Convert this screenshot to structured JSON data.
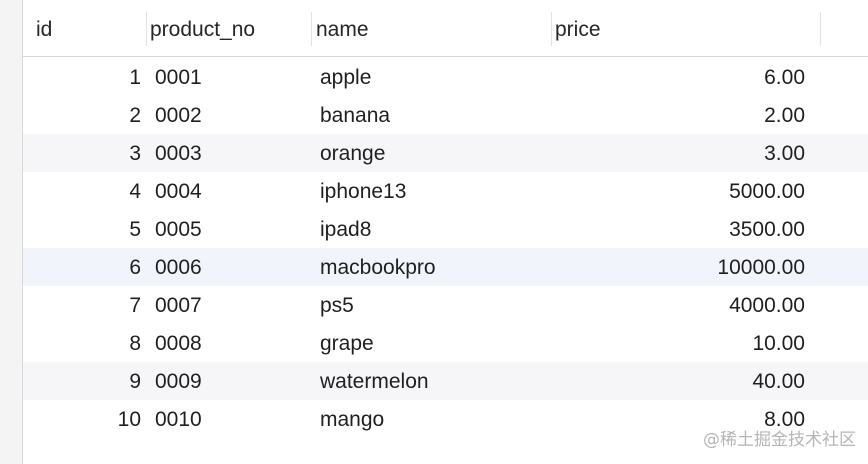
{
  "table": {
    "columns": [
      "id",
      "product_no",
      "name",
      "price"
    ],
    "rows": [
      {
        "id": "1",
        "product_no": "0001",
        "name": "apple",
        "price": "6.00"
      },
      {
        "id": "2",
        "product_no": "0002",
        "name": "banana",
        "price": "2.00"
      },
      {
        "id": "3",
        "product_no": "0003",
        "name": "orange",
        "price": "3.00"
      },
      {
        "id": "4",
        "product_no": "0004",
        "name": "iphone13",
        "price": "5000.00"
      },
      {
        "id": "5",
        "product_no": "0005",
        "name": "ipad8",
        "price": "3500.00"
      },
      {
        "id": "6",
        "product_no": "0006",
        "name": "macbookpro",
        "price": "10000.00"
      },
      {
        "id": "7",
        "product_no": "0007",
        "name": "ps5",
        "price": "4000.00"
      },
      {
        "id": "8",
        "product_no": "0008",
        "name": "grape",
        "price": "10.00"
      },
      {
        "id": "9",
        "product_no": "0009",
        "name": "watermelon",
        "price": "40.00"
      },
      {
        "id": "10",
        "product_no": "0010",
        "name": "mango",
        "price": "8.00"
      }
    ]
  },
  "watermark": "@稀土掘金技术社区"
}
